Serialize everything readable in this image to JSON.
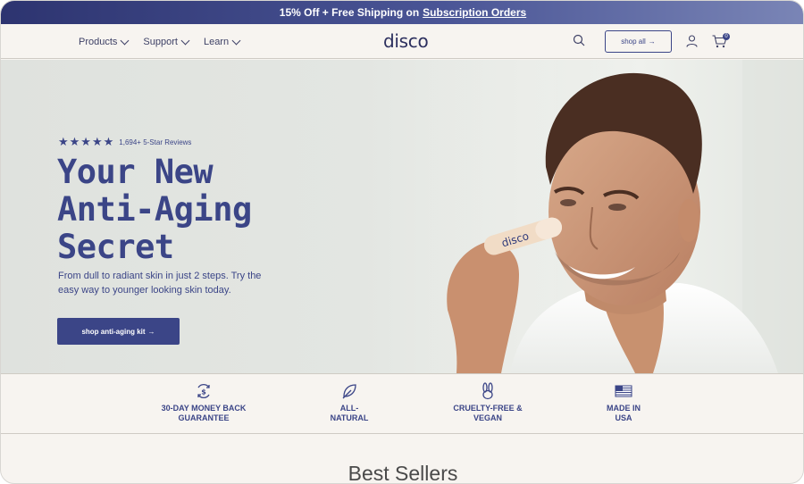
{
  "promo": {
    "text": "15% Off + Free Shipping on",
    "link": "Subscription Orders"
  },
  "header": {
    "nav": [
      {
        "label": "Products"
      },
      {
        "label": "Support"
      },
      {
        "label": "Learn"
      }
    ],
    "logo": "disco",
    "shop_all_label": "shop all",
    "cart_count": "0"
  },
  "hero": {
    "stars": "★★★★★",
    "rating_text": "1,694+ 5-Star Reviews",
    "headline": [
      "Your New",
      "Anti-Aging",
      "Secret"
    ],
    "subtext": "From dull to radiant skin in just 2 steps. Try the easy way to younger looking skin today.",
    "cta_label": "shop anti-aging kit",
    "stick_brand": "disco"
  },
  "features": [
    {
      "icon": "money-back-icon",
      "label": "30-DAY MONEY BACK GUARANTEE"
    },
    {
      "icon": "leaf-icon",
      "label": "ALL- NATURAL"
    },
    {
      "icon": "bunny-icon",
      "label": "CRUELTY-FREE & VEGAN"
    },
    {
      "icon": "us-flag-icon",
      "label": "MADE IN USA"
    }
  ],
  "section_title": "Best Sellers",
  "colors": {
    "brand": "#3b4587",
    "promo_start": "#2d3470",
    "background": "#f7f4f0"
  }
}
